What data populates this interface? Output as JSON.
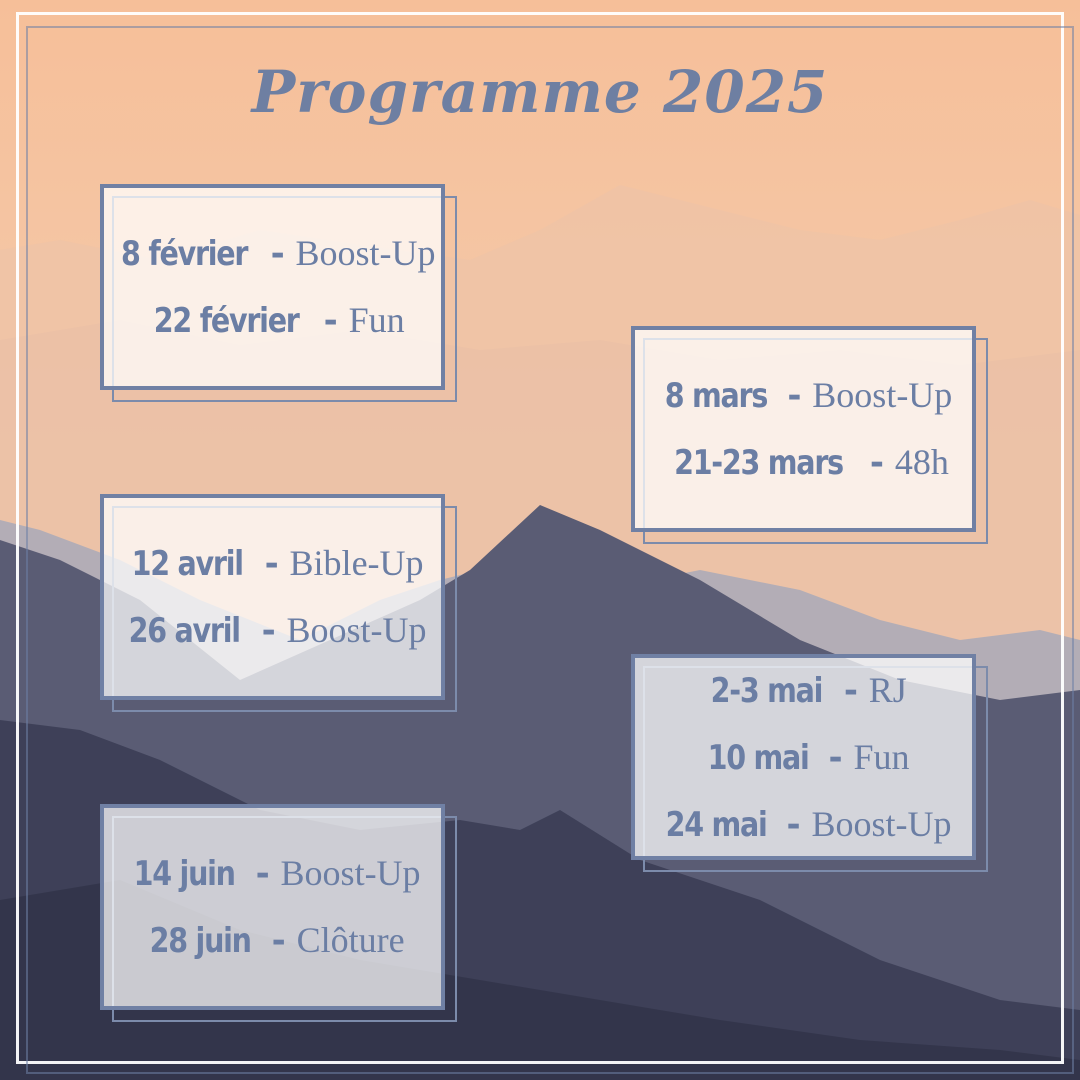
{
  "title": "Programme 2025",
  "colors": {
    "accent": "#6e7fa2",
    "card_border": "#7080a4",
    "frame": "#ffffff"
  },
  "cards": [
    {
      "events": [
        {
          "date": "8 février",
          "sep": "-",
          "name": "Boost-Up"
        },
        {
          "date": "22 février",
          "sep": "-",
          "name": "Fun"
        }
      ]
    },
    {
      "events": [
        {
          "date": "8 mars",
          "sep": "-",
          "name": "Boost-Up"
        },
        {
          "date": "21-23 mars",
          "sep": "-",
          "name": "48h"
        }
      ]
    },
    {
      "events": [
        {
          "date": "12 avril",
          "sep": "-",
          "name": "Bible-Up"
        },
        {
          "date": "26 avril",
          "sep": "-",
          "name": "Boost-Up"
        }
      ]
    },
    {
      "events": [
        {
          "date": "2-3 mai",
          "sep": "-",
          "name": "RJ"
        },
        {
          "date": "10 mai",
          "sep": "-",
          "name": "Fun"
        },
        {
          "date": "24 mai",
          "sep": "-",
          "name": "Boost-Up"
        }
      ]
    },
    {
      "events": [
        {
          "date": "14 juin",
          "sep": "-",
          "name": "Boost-Up"
        },
        {
          "date": "28 juin",
          "sep": "-",
          "name": "Clôture"
        }
      ]
    }
  ]
}
